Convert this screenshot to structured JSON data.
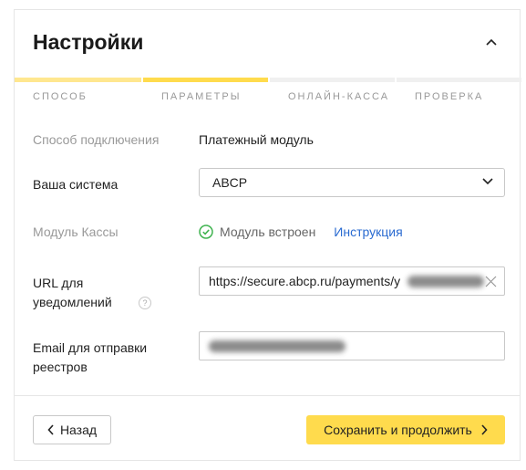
{
  "header": {
    "title": "Настройки"
  },
  "steps": [
    {
      "label": "Способ",
      "state": "done",
      "bar_color": "#ffe78f"
    },
    {
      "label": "Параметры",
      "state": "active",
      "bar_color": "#ffdb4d"
    },
    {
      "label": "Онлайн-касса",
      "state": "pending",
      "bar_color": "#f0f0f0"
    },
    {
      "label": "Проверка",
      "state": "pending",
      "bar_color": "#f0f0f0"
    }
  ],
  "form": {
    "connection": {
      "label": "Способ подключения",
      "value": "Платежный модуль"
    },
    "system": {
      "label": "Ваша система",
      "selected": "ABCP"
    },
    "module": {
      "label": "Модуль Кассы",
      "status": "Модуль встроен",
      "link": "Инструкция"
    },
    "url": {
      "label": "URL для уведомлений",
      "value": "https://secure.abcp.ru/payments/y",
      "help": "?"
    },
    "email": {
      "label": "Email для отправки реестров",
      "value": ""
    }
  },
  "footer": {
    "back": "Назад",
    "save": "Сохранить и продолжить"
  },
  "colors": {
    "accent": "#ffdb4d",
    "link": "#2a6bd1",
    "success": "#3fb34f"
  },
  "icons": {
    "collapse": "chevron-up-icon",
    "select": "chevron-down-icon",
    "status": "check-circle-icon",
    "clear": "close-icon",
    "back": "chevron-left-icon",
    "save": "chevron-right-icon"
  }
}
